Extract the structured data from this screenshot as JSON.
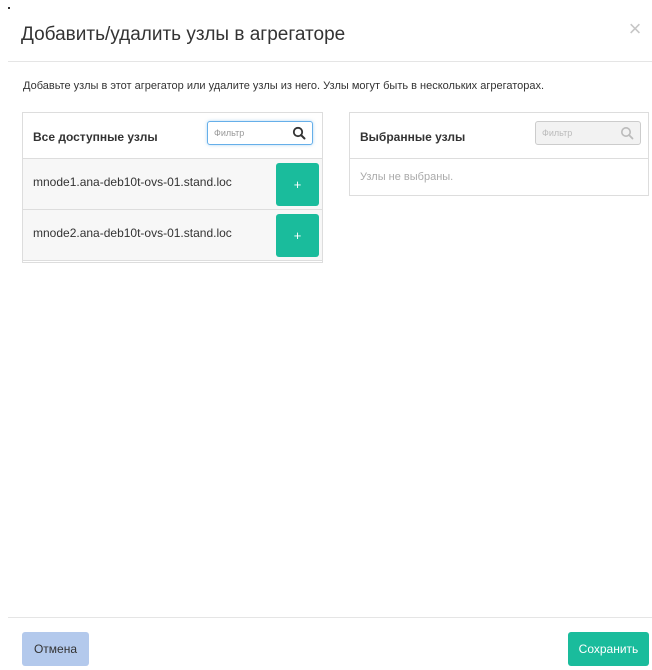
{
  "modal": {
    "title": "Добавить/удалить узлы в агрегаторе",
    "close_icon": "close-icon",
    "description": "Добавьте узлы в этот агрегатор или удалите узлы из него. Узлы могут быть в нескольких агрегаторах."
  },
  "available": {
    "title": "Все доступные узлы",
    "filter_placeholder": "Фильтр",
    "filter_value": "",
    "items": [
      {
        "label": "mnode1.ana-deb10t-ovs-01.stand.loc",
        "add_label": "+"
      },
      {
        "label": "mnode2.ana-deb10t-ovs-01.stand.loc",
        "add_label": "+"
      }
    ]
  },
  "selected": {
    "title": "Выбранные узлы",
    "filter_placeholder": "Фильтр",
    "empty_text": "Узлы не выбраны."
  },
  "footer": {
    "cancel_label": "Отмена",
    "save_label": "Сохранить"
  },
  "colors": {
    "accent": "#1abc9c",
    "cancel_bg": "#b3c9ec",
    "filter_focus": "#66afe9"
  }
}
